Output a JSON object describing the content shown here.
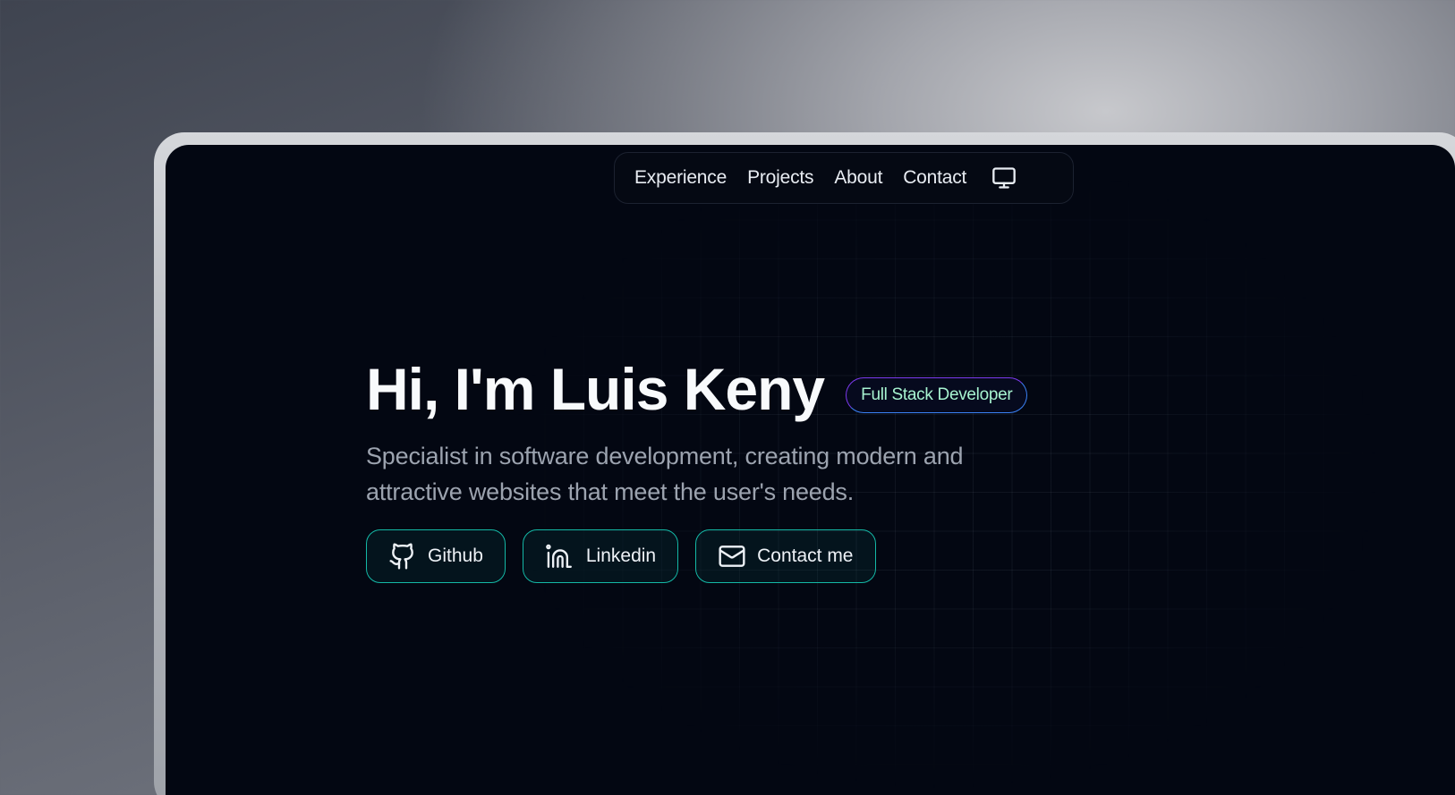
{
  "nav": {
    "items": [
      {
        "label": "Experience"
      },
      {
        "label": "Projects"
      },
      {
        "label": "About"
      },
      {
        "label": "Contact"
      }
    ],
    "theme_icon": "monitor-icon"
  },
  "hero": {
    "title": "Hi, I'm Luis Keny",
    "badge": "Full Stack Developer",
    "description": "Specialist in software development, creating modern and attractive websites that meet the user's needs.",
    "buttons": [
      {
        "label": "Github",
        "icon": "github-icon"
      },
      {
        "label": "Linkedin",
        "icon": "linkedin-icon"
      },
      {
        "label": "Contact me",
        "icon": "mail-icon"
      }
    ]
  },
  "colors": {
    "background": "#030712",
    "accent": "#14b8a6",
    "badge_text": "#a7f3d0",
    "badge_border": "#7c3aed"
  }
}
